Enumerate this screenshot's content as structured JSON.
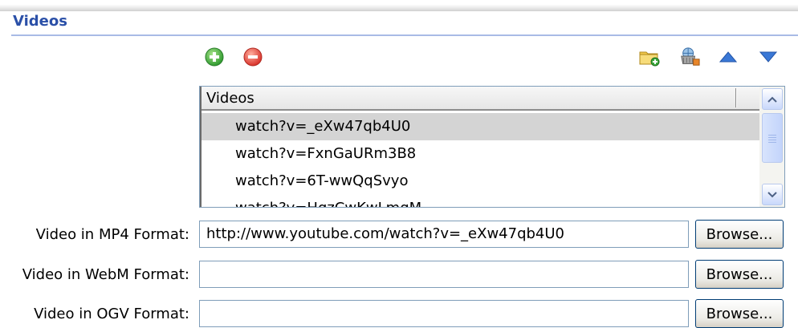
{
  "section": {
    "title": "Videos"
  },
  "toolbar": {
    "add_icon": "plus-circle-icon",
    "remove_icon": "minus-circle-icon",
    "add_folder_icon": "folder-add-icon",
    "catalog_icon": "web-basket-icon",
    "move_up_icon": "triangle-up-icon",
    "move_down_icon": "triangle-down-icon"
  },
  "video_list": {
    "header": "Videos",
    "items": [
      {
        "label": "watch?v=_eXw47qb4U0",
        "selected": true
      },
      {
        "label": "watch?v=FxnGaURm3B8",
        "selected": false
      },
      {
        "label": "watch?v=6T-wwQqSvyo",
        "selected": false
      },
      {
        "label": "watch?v=HqzCwKwLmqM",
        "selected": false
      }
    ]
  },
  "fields": {
    "mp4": {
      "label": "Video in MP4 Format:",
      "value": "http://www.youtube.com/watch?v=_eXw47qb4U0",
      "button": "Browse..."
    },
    "webm": {
      "label": "Video in WebM Format:",
      "value": "",
      "button": "Browse..."
    },
    "ogv": {
      "label": "Video in OGV Format:",
      "value": "",
      "button": "Browse..."
    }
  },
  "colors": {
    "title": "#2b50a8",
    "rule": "#a9bbe6",
    "add_green": "#3aa83a",
    "remove_red": "#e0403a",
    "arrow_blue": "#3a78d6",
    "selection": "#d4d4d4"
  }
}
